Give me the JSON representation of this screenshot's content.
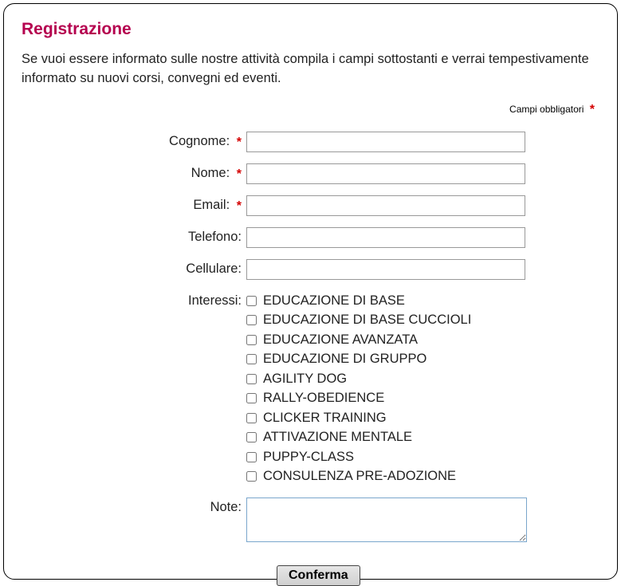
{
  "title": "Registrazione",
  "intro": "Se vuoi essere informato sulle nostre attività compila i campi sottostanti e verrai tempestivamente informato su nuovi corsi, convegni ed eventi.",
  "required_note": "Campi obbligatori",
  "asterisk": "*",
  "fields": {
    "cognome": {
      "label": "Cognome:",
      "required": true,
      "value": ""
    },
    "nome": {
      "label": "Nome:",
      "required": true,
      "value": ""
    },
    "email": {
      "label": "Email:",
      "required": true,
      "value": ""
    },
    "telefono": {
      "label": "Telefono:",
      "required": false,
      "value": ""
    },
    "cellulare": {
      "label": "Cellulare:",
      "required": false,
      "value": ""
    },
    "interessi": {
      "label": "Interessi:"
    },
    "note": {
      "label": "Note:",
      "value": ""
    }
  },
  "interests": [
    "EDUCAZIONE DI BASE",
    "EDUCAZIONE DI BASE CUCCIOLI",
    "EDUCAZIONE AVANZATA",
    "EDUCAZIONE DI GRUPPO",
    "AGILITY DOG",
    "RALLY-OBEDIENCE",
    "CLICKER TRAINING",
    "ATTIVAZIONE MENTALE",
    "PUPPY-CLASS",
    "CONSULENZA PRE-ADOZIONE"
  ],
  "submit_label": "Conferma"
}
